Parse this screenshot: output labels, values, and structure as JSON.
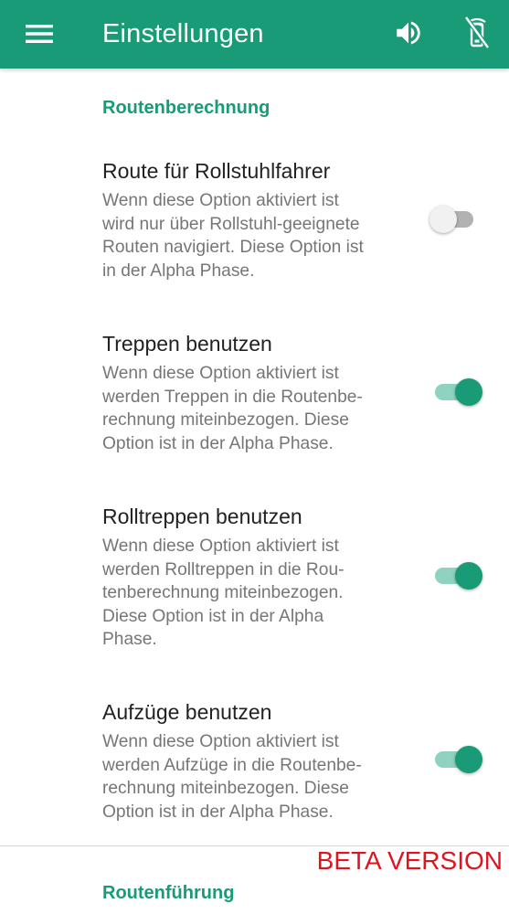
{
  "appbar": {
    "title": "Einstellungen",
    "background": "#1a9b78",
    "icons": {
      "menu": "menu-icon",
      "sound": "volume-up-icon",
      "disable": "phone-disabled-icon"
    }
  },
  "sections": [
    {
      "header": "Routenberechnung",
      "preferences": [
        {
          "title": "Route für Rollstuhlfahrer",
          "summary_lines": [
            "Wenn diese Option aktiviert ist",
            "wird nur über Rollstuhl-geeignete",
            "Routen navigiert. Diese Option ist",
            "in der Alpha Phase."
          ],
          "enabled": false
        },
        {
          "title": "Treppen benutzen",
          "summary_lines": [
            "Wenn diese Option aktiviert ist",
            "werden Treppen in die Routenbe-",
            "rechnung miteinbezogen. Diese",
            "Option ist in der Alpha Phase."
          ],
          "enabled": true
        },
        {
          "title": "Rolltreppen benutzen",
          "summary_lines": [
            "Wenn diese Option aktiviert ist",
            "werden Rolltreppen in die Rou-",
            "tenberechnung miteinbezogen.",
            "Diese Option ist in der Alpha",
            "Phase."
          ],
          "enabled": true
        },
        {
          "title": "Aufzüge benutzen",
          "summary_lines": [
            "Wenn diese Option aktiviert ist",
            "werden Aufzüge in die Routenbe-",
            "rechnung miteinbezogen. Diese",
            "Option ist in der Alpha Phase."
          ],
          "enabled": true
        }
      ]
    },
    {
      "header": "Routenführung",
      "preferences": []
    }
  ],
  "beta_label": "BETA VERSION",
  "colors": {
    "accent": "#1a9b78",
    "switch_track_on": "#8fd2bf",
    "switch_track_off": "#b2b2b2",
    "beta": "#e0141e"
  }
}
